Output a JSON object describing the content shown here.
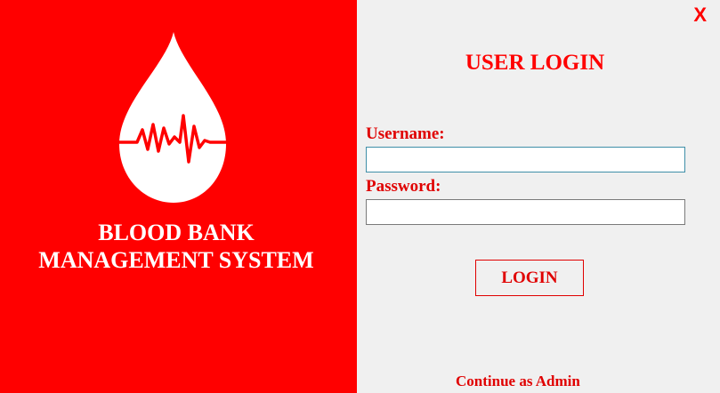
{
  "window": {
    "close_label": "X"
  },
  "branding": {
    "logo_icon": "blood-drop-heartbeat-icon",
    "title_line1": "BLOOD BANK",
    "title_line2": "MANAGEMENT SYSTEM"
  },
  "login": {
    "title": "USER LOGIN",
    "username_label": "Username:",
    "username_value": "",
    "password_label": "Password:",
    "password_value": "",
    "submit_label": "LOGIN",
    "admin_link": "Continue as Admin"
  },
  "colors": {
    "brand_red": "#ff0000",
    "text_red": "#e00000",
    "panel_bg": "#f0f0f0",
    "white": "#ffffff"
  }
}
